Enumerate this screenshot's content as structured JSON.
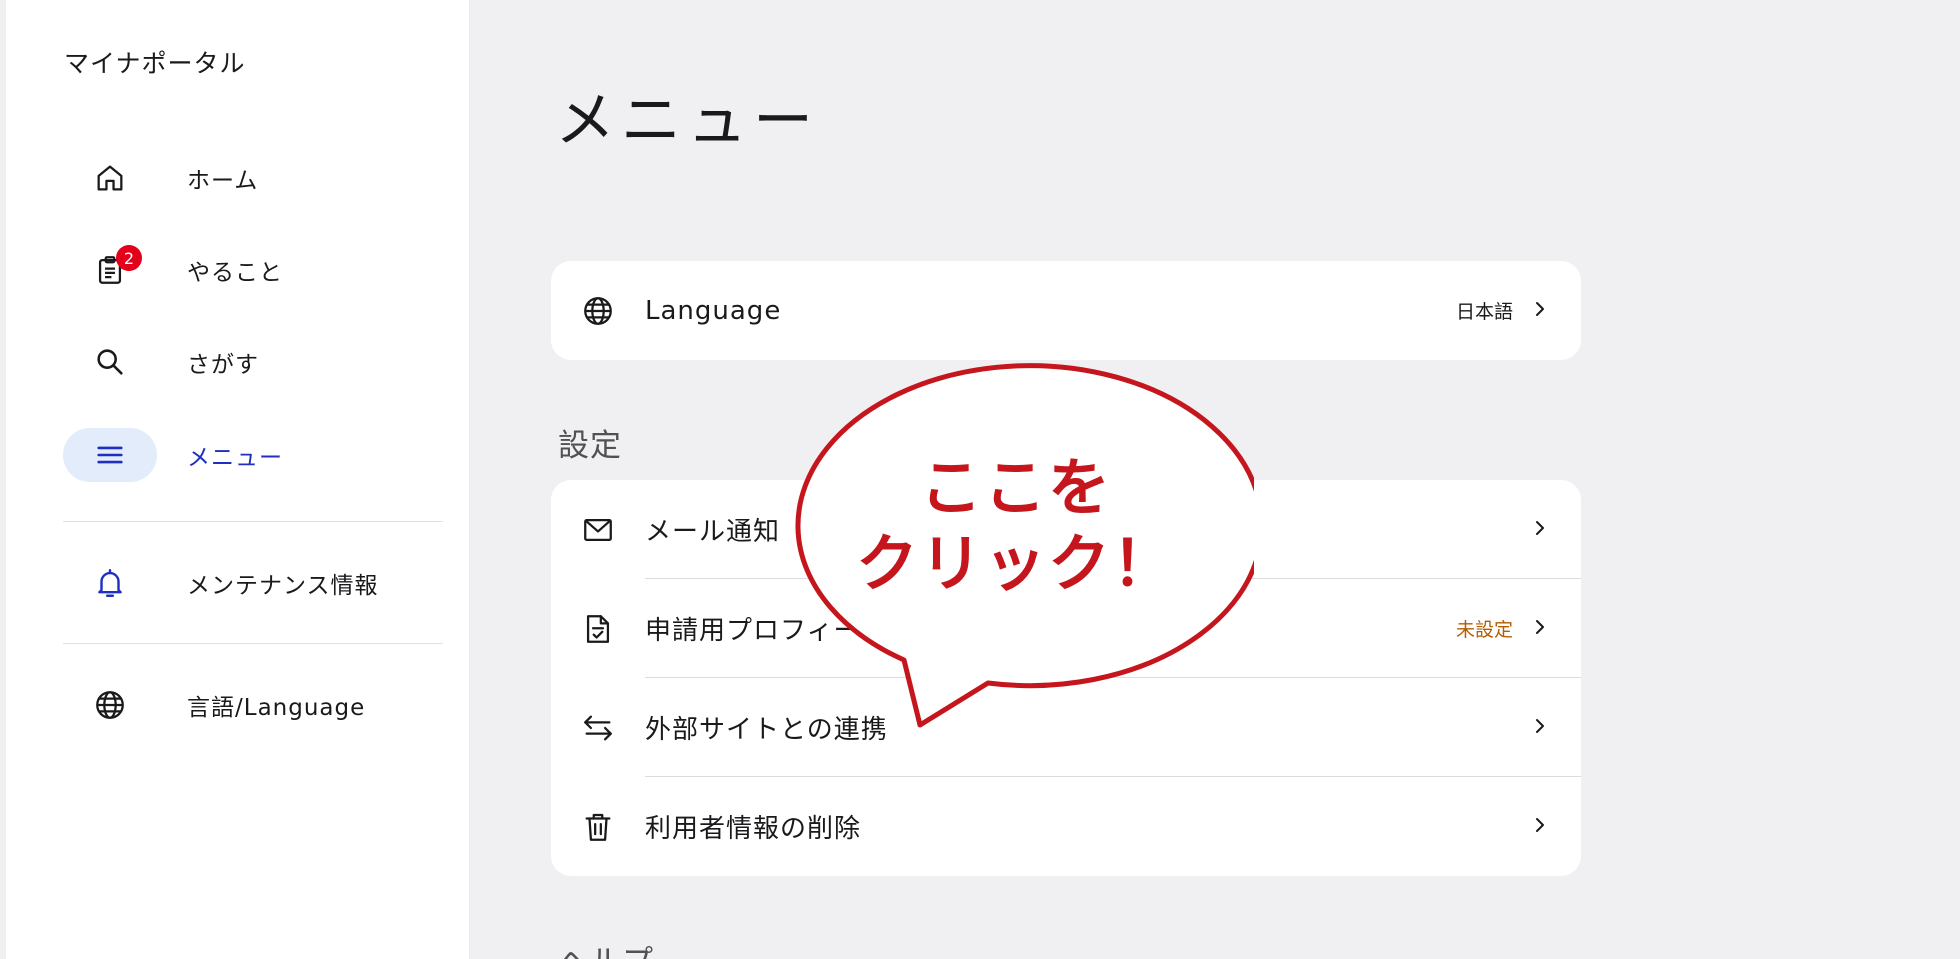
{
  "sidebar": {
    "brand": "マイナポータル",
    "items": [
      {
        "label": "ホーム",
        "icon": "home-icon"
      },
      {
        "label": "やること",
        "icon": "clipboard-icon",
        "badge": "2"
      },
      {
        "label": "さがす",
        "icon": "search-icon"
      },
      {
        "label": "メニュー",
        "icon": "menu-icon",
        "active": true
      },
      {
        "label": "メンテナンス情報",
        "icon": "bell-icon"
      },
      {
        "label": "言語/Language",
        "icon": "globe-icon"
      }
    ]
  },
  "main": {
    "title": "メニュー",
    "language_row": {
      "label": "Language",
      "value": "日本語",
      "icon": "globe-icon"
    },
    "settings": {
      "title": "設定",
      "rows": [
        {
          "label": "メール通知",
          "icon": "mail-icon",
          "value": ""
        },
        {
          "label": "申請用プロフィール",
          "icon": "document-check-icon",
          "value": "未設定"
        },
        {
          "label": "外部サイトとの連携",
          "icon": "swap-arrows-icon",
          "value": ""
        },
        {
          "label": "利用者情報の削除",
          "icon": "trash-icon",
          "value": ""
        }
      ]
    },
    "help": {
      "title": "ヘルプ"
    }
  },
  "callout": {
    "line1": "ここを",
    "line2": "クリック！"
  },
  "colors": {
    "accent": "#1f2fbf",
    "active_bg": "#e3ecfb",
    "badge": "#e3001a",
    "warning": "#b25e00",
    "callout": "#c4161c",
    "background": "#f0f0f2"
  }
}
